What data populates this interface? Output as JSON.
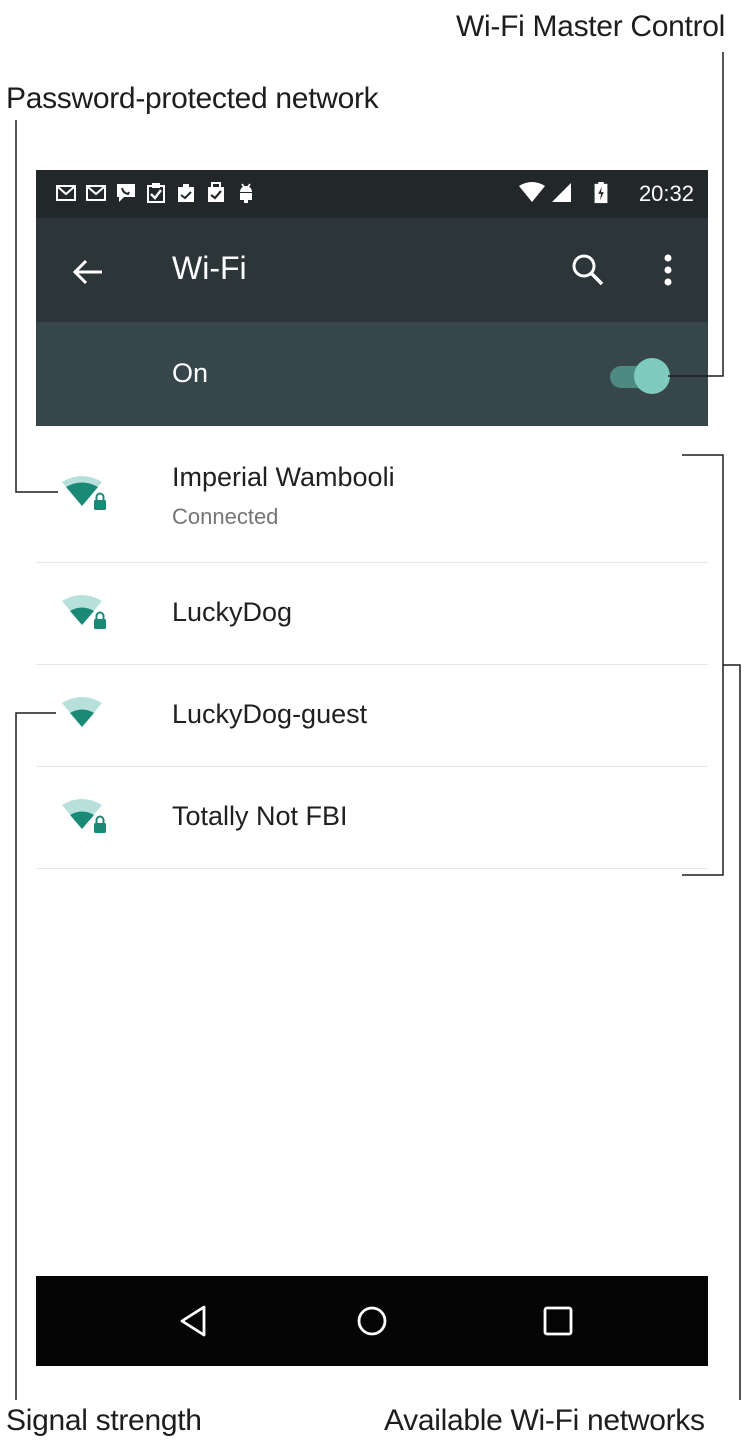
{
  "annotations": {
    "master_control": "Wi-Fi Master Control",
    "password_protected": "Password-protected network",
    "signal_strength": "Signal strength",
    "available_networks": "Available Wi-Fi networks"
  },
  "status_bar": {
    "time": "20:32",
    "notification_icons": [
      "gmail-icon",
      "gmail-icon",
      "missed-call-icon",
      "task-icon",
      "clipboard-icon",
      "task-icon",
      "android-icon"
    ],
    "system_icons": [
      "wifi-icon",
      "cell-signal-icon",
      "battery-charging-icon"
    ]
  },
  "app_bar": {
    "title": "Wi-Fi",
    "back_icon": "arrow-back-icon",
    "search_icon": "search-icon",
    "more_icon": "more-vert-icon"
  },
  "master_switch": {
    "label": "On",
    "enabled": true
  },
  "networks": [
    {
      "name": "Imperial Wambooli",
      "status": "Connected",
      "secured": true,
      "signal": 3
    },
    {
      "name": "LuckyDog",
      "status": "",
      "secured": true,
      "signal": 2
    },
    {
      "name": "LuckyDog-guest",
      "status": "",
      "secured": false,
      "signal": 2
    },
    {
      "name": "Totally Not FBI",
      "status": "",
      "secured": true,
      "signal": 2
    }
  ],
  "nav_bar": [
    "back-triangle-icon",
    "home-circle-icon",
    "recents-square-icon"
  ],
  "colors": {
    "status_bar": "#22272a",
    "app_bar": "#2c3538",
    "switch_bar": "#37464b",
    "accent": "#7fcbc0",
    "wifi_strong": "#1a8a76",
    "wifi_weak": "#b7e0da"
  }
}
